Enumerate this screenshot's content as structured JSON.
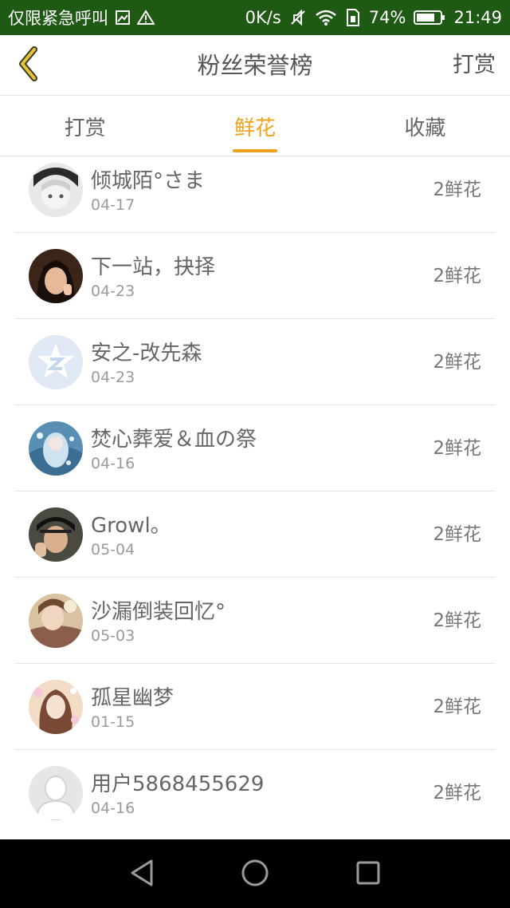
{
  "status_bar": {
    "left_text": "仅限紧急呼叫",
    "speed": "0K/s",
    "battery": "74%",
    "time": "21:49",
    "bg_color": "#1f5a14"
  },
  "header": {
    "title": "粉丝荣誉榜",
    "action_label": "打赏",
    "back_icon": "chevron-left-icon",
    "accent_color": "#f0a21a"
  },
  "tabs": [
    {
      "label": "打赏",
      "active": false
    },
    {
      "label": "鲜花",
      "active": true
    },
    {
      "label": "收藏",
      "active": false
    }
  ],
  "list": {
    "items": [
      {
        "name": "倾城陌°さま",
        "date": "04-17",
        "reward": "2鲜花"
      },
      {
        "name": "下一站，抉择",
        "date": "04-23",
        "reward": "2鲜花"
      },
      {
        "name": "安之-改先森",
        "date": "04-23",
        "reward": "2鲜花"
      },
      {
        "name": "焚心葬爱＆血の祭",
        "date": "04-16",
        "reward": "2鲜花"
      },
      {
        "name": "Growl。",
        "date": "05-04",
        "reward": "2鲜花"
      },
      {
        "name": "沙漏倒装回忆°",
        "date": "05-03",
        "reward": "2鲜花"
      },
      {
        "name": "孤星幽梦",
        "date": "01-15",
        "reward": "2鲜花"
      },
      {
        "name": "用户5868455629",
        "date": "04-16",
        "reward": "2鲜花"
      }
    ]
  },
  "nav_bar": {
    "back": "triangle-back-icon",
    "home": "circle-home-icon",
    "recents": "square-recents-icon"
  }
}
